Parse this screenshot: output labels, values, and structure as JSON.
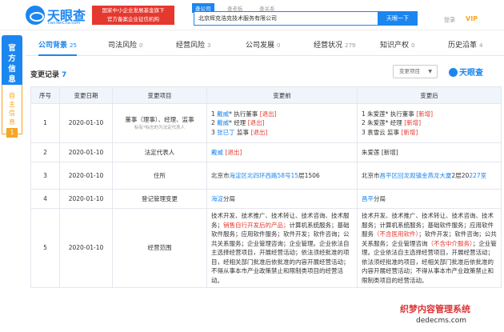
{
  "header": {
    "logo": "天眼查",
    "logo_url": "TianYanCha.com",
    "badge_line1": "国家中小企业发展基金旗下",
    "badge_line2": "官方备案企业征信机构",
    "search_tabs": [
      "查公司",
      "查老板",
      "查关系"
    ],
    "search_value": "北京辉克浩克技术服务有限公司",
    "search_button": "天眼一下",
    "login": "登录",
    "vip": "VIP"
  },
  "sidebar": {
    "item1": "官方信息",
    "item2": "自主信息",
    "item2_count": "1"
  },
  "tabs": [
    {
      "label": "公司背景",
      "count": "25"
    },
    {
      "label": "司法风险",
      "count": "0"
    },
    {
      "label": "经营风险",
      "count": "3"
    },
    {
      "label": "公司发展",
      "count": "0"
    },
    {
      "label": "经营状况",
      "count": "279"
    },
    {
      "label": "知识产权",
      "count": "0"
    },
    {
      "label": "历史沿革",
      "count": "4"
    }
  ],
  "section": {
    "title": "变更记录",
    "count": "7",
    "filter": "变更项目",
    "watermark": "天眼查"
  },
  "table": {
    "headers": [
      "序号",
      "变更日期",
      "变更项目",
      "变更前",
      "变更后"
    ],
    "rows": [
      {
        "n": "1",
        "date": "2020-01-10",
        "item": "董事（理事）、经理、监事",
        "item_note": "标有*标志的为法定代表人"
      },
      {
        "n": "2",
        "date": "2020-01-10",
        "item": "法定代表人"
      },
      {
        "n": "3",
        "date": "2020-01-10",
        "item": "住所"
      },
      {
        "n": "4",
        "date": "2020-01-10",
        "item": "登记管理变更"
      },
      {
        "n": "5",
        "date": "2020-01-10",
        "item": "经营范围"
      }
    ],
    "r1_before": [
      [
        "1 ",
        "戴威",
        "* 执行董事 ",
        "[退出]"
      ],
      [
        "2 ",
        "戴威",
        "* 经理 ",
        "[退出]"
      ],
      [
        "3 ",
        "张已丁",
        " 监事 ",
        "[退出]"
      ]
    ],
    "r1_after": [
      [
        "1 ",
        "朱爱莲",
        "* 执行董事 ",
        "[新增]"
      ],
      [
        "2 ",
        "朱爱莲",
        "* 经理 ",
        "[新增]"
      ],
      [
        "3 ",
        "袁雪云",
        " 监事 ",
        "[新增]"
      ]
    ],
    "r2_before_name": "戴威",
    "r2_before_tag": "[退出]",
    "r2_after": "朱爱莲 [新增]",
    "r3_before": [
      "北京市",
      "海淀区",
      "北四环西路58号15",
      "层1506"
    ],
    "r3_after": [
      "北京市",
      "昌平区",
      "回龙观镇金燕龙大厦",
      "2层20",
      "227室"
    ],
    "r4_before": [
      "海淀",
      "分局"
    ],
    "r4_after": [
      "昌平",
      "分局"
    ],
    "r5_before": [
      "技术开发、技术推广、技术转让、技术咨询、技术服务；",
      "销售自行开发后的产品；",
      "计算机系统服务；基础软件服务；应用软件服务；软件开发；软件咨询；公共关系服务；企业管理咨询；企业管理。企业依法自主选择经营项目，开展经营活动；依法须经批准的项目，经相关部门批准后依批准的内容开展经营活动；不得从事本市产业政策禁止和限制类项目的经营活动。"
    ],
    "r5_after": [
      "技术开发、技术推广、技术转让、技术咨询、技术服务；计算机系统服务；基础软件服务；应用软件服务",
      "（不含医用软件）",
      "；软件开发；软件咨询；公共关系服务；企业管理咨询",
      "（不含中介服务）",
      "；企业管理。企业依法自主选择经营项目，开展经营活动；依法须经批准的项目，经相关部门批准后依批准的内容开展经营活动；不得从事本市产业政策禁止和限制类项目的经营活动。"
    ]
  },
  "bottom_watermark": {
    "line1": "织梦内容管理系统",
    "line2": "dedecms.com"
  }
}
